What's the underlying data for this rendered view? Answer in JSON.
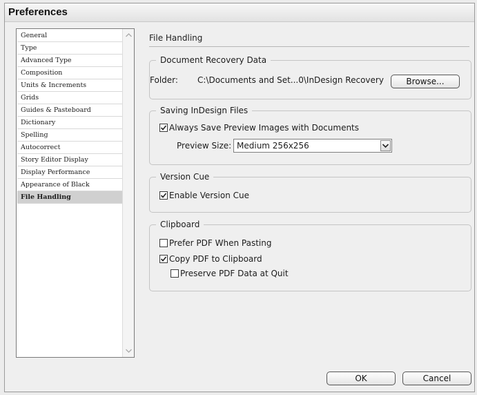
{
  "window": {
    "title": "Preferences"
  },
  "categories": [
    "General",
    "Type",
    "Advanced Type",
    "Composition",
    "Units & Increments",
    "Grids",
    "Guides & Pasteboard",
    "Dictionary",
    "Spelling",
    "Autocorrect",
    "Story Editor Display",
    "Display Performance",
    "Appearance of Black",
    "File Handling"
  ],
  "selected_category": "File Handling",
  "panel": {
    "title": "File Handling",
    "recovery": {
      "legend": "Document Recovery Data",
      "folder_label": "Folder:",
      "folder_path": "C:\\Documents and Set...0\\InDesign Recovery",
      "browse_label": "Browse..."
    },
    "saving": {
      "legend": "Saving InDesign Files",
      "always_save_label": "Always Save Preview Images with Documents",
      "always_save_checked": true,
      "preview_size_label": "Preview Size:",
      "preview_size_value": "Medium 256x256"
    },
    "version_cue": {
      "legend": "Version Cue",
      "enable_label": "Enable Version Cue",
      "enable_checked": true
    },
    "clipboard": {
      "legend": "Clipboard",
      "prefer_pdf_label": "Prefer PDF When Pasting",
      "prefer_pdf_checked": false,
      "copy_pdf_label": "Copy PDF to Clipboard",
      "copy_pdf_checked": true,
      "preserve_pdf_label": "Preserve PDF Data at Quit",
      "preserve_pdf_checked": false
    }
  },
  "buttons": {
    "ok": "OK",
    "cancel": "Cancel"
  }
}
